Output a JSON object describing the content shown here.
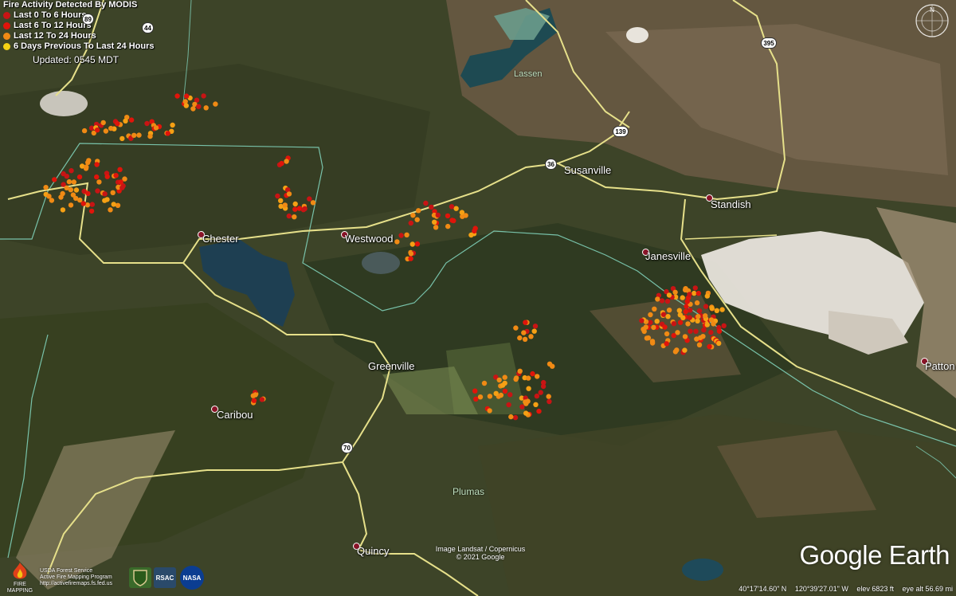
{
  "legend": {
    "title": "Fire Activity Detected By MODIS",
    "items": [
      {
        "label": "Last 0 To 6 Hours",
        "color": "#c81414"
      },
      {
        "label": "Last 6 To 12 Hours",
        "color": "#e0140a"
      },
      {
        "label": "Last 12 To 24 Hours",
        "color": "#f08a14"
      },
      {
        "label": "6 Days Previous To Last 24 Hours",
        "color": "#f5d214"
      }
    ],
    "updated": "Updated: 0545 MDT"
  },
  "places": {
    "chester": "Chester",
    "westwood": "Westwood",
    "susanville": "Susanville",
    "standish": "Standish",
    "janesville": "Janesville",
    "greenville": "Greenville",
    "caribou": "Caribou",
    "quincy": "Quincy",
    "patton": "Patton",
    "lassen": "Lassen",
    "plumas": "Plumas"
  },
  "highways": {
    "h89": "89",
    "h44": "44",
    "h395": "395",
    "h139": "139",
    "h36": "36",
    "h70": "70"
  },
  "credits": {
    "imagery": "Image Landsat / Copernicus",
    "copyright": "© 2021 Google",
    "brand": "Google Earth",
    "usda": "USDA Forest Service",
    "program": "Active Fire Mapping Program",
    "url": "http://activefiremaps.fs.fed.us",
    "fire_mapping": "FIRE MAPPING",
    "rsac": "RSAC",
    "nasa": "NASA"
  },
  "status": {
    "lat": "40°17'14.60\" N",
    "lon": "120°39'27.01\" W",
    "elev": "elev  6823 ft",
    "eye": "eye alt  56.69 mi"
  },
  "compass_label": "N",
  "colors": {
    "road": "#e6e08a",
    "boundary": "#7fd0b8",
    "water": "#1e3f52",
    "lakebed": "#e8e4dc"
  }
}
